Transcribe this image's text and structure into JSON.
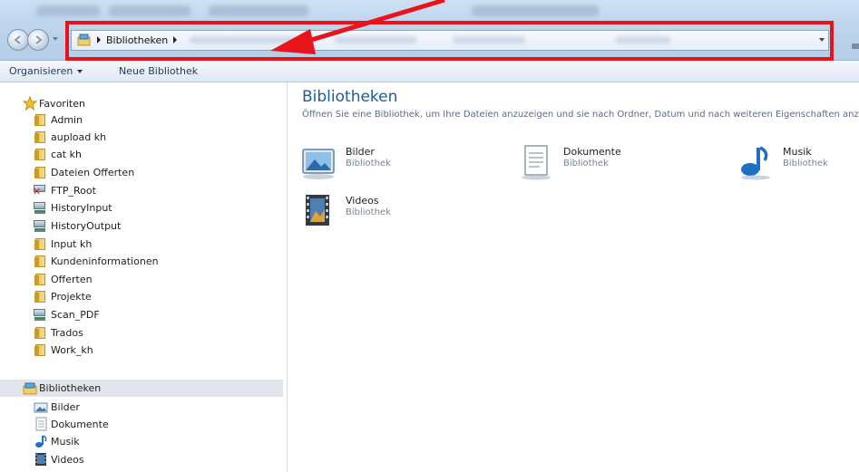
{
  "address_bar": {
    "location": "Bibliotheken"
  },
  "toolbar": {
    "organize_label": "Organisieren",
    "new_library_label": "Neue Bibliothek"
  },
  "sidebar": {
    "favorites_label": "Favoriten",
    "favorites": [
      {
        "label": "Admin",
        "icon": "folder-icon"
      },
      {
        "label": "aupload kh",
        "icon": "folder-icon"
      },
      {
        "label": "cat kh",
        "icon": "folder-icon"
      },
      {
        "label": "Dateien Offerten",
        "icon": "folder-icon"
      },
      {
        "label": "FTP_Root",
        "icon": "disconnected-drive-icon"
      },
      {
        "label": "HistoryInput",
        "icon": "network-drive-icon"
      },
      {
        "label": "HistoryOutput",
        "icon": "network-drive-icon"
      },
      {
        "label": "Input kh",
        "icon": "folder-icon"
      },
      {
        "label": "Kundeninformationen",
        "icon": "folder-icon"
      },
      {
        "label": "Offerten",
        "icon": "folder-icon"
      },
      {
        "label": "Projekte",
        "icon": "folder-icon"
      },
      {
        "label": "Scan_PDF",
        "icon": "network-drive-icon"
      },
      {
        "label": "Trados",
        "icon": "folder-icon"
      },
      {
        "label": "Work_kh",
        "icon": "folder-icon"
      }
    ],
    "libraries_label": "Bibliotheken",
    "libraries": [
      {
        "label": "Bilder",
        "icon": "pictures-library-icon"
      },
      {
        "label": "Dokumente",
        "icon": "documents-library-icon"
      },
      {
        "label": "Musik",
        "icon": "music-library-icon"
      },
      {
        "label": "Videos",
        "icon": "videos-library-icon"
      }
    ]
  },
  "main": {
    "title": "Bibliotheken",
    "subtitle": "Öffnen Sie eine Bibliothek, um Ihre Dateien anzuzeigen und sie nach Ordner, Datum und nach weiteren Eigenschaften anzuo",
    "libraries": [
      {
        "name": "Bilder",
        "type": "Bibliothek",
        "icon": "pictures-library-icon"
      },
      {
        "name": "Dokumente",
        "type": "Bibliothek",
        "icon": "documents-library-icon"
      },
      {
        "name": "Musik",
        "type": "Bibliothek",
        "icon": "music-library-icon"
      },
      {
        "name": "Videos",
        "type": "Bibliothek",
        "icon": "videos-library-icon"
      }
    ]
  },
  "annotation": {
    "highlight_color": "#e8141b"
  },
  "colors": {
    "title_blue": "#1e5b9b",
    "toolbar_text": "#1e395b",
    "selected_row": "#e2e6ec"
  }
}
